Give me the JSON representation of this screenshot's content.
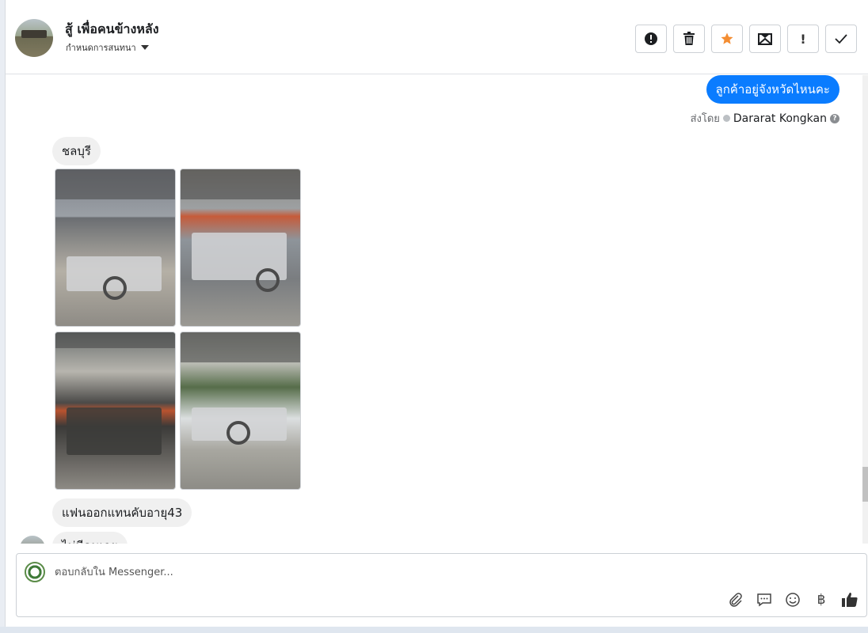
{
  "header": {
    "contact_name": "สู้ เพื่อคนข้างหลัง",
    "label_dropdown": "กำหนดการสนทนา",
    "actions": [
      {
        "name": "spam-button",
        "glyph": "!"
      },
      {
        "name": "delete-button",
        "glyph": "trash"
      },
      {
        "name": "star-button",
        "glyph": "★"
      },
      {
        "name": "mark-unread-button",
        "glyph": "envelope"
      },
      {
        "name": "follow-up-button",
        "glyph": "!"
      },
      {
        "name": "mark-done-button",
        "glyph": "✓"
      }
    ],
    "accent_star": "#f48d32"
  },
  "messages": {
    "outgoing_text": "ลูกค้าอยู่จังหวัดไหนคะ",
    "sent_by_prefix": "ส่งโดย",
    "sent_by_name": "Dararat Kongkan",
    "incoming_1": "ชลบุรี",
    "incoming_2": "แฟนออกแทนคับอายุ43",
    "incoming_3": "ไม่มีคนเลย"
  },
  "composer": {
    "placeholder": "ตอบกลับใน Messenger..."
  },
  "colors": {
    "outgoing_bubble": "#0a7cff",
    "incoming_bubble": "#f0f0f0"
  }
}
